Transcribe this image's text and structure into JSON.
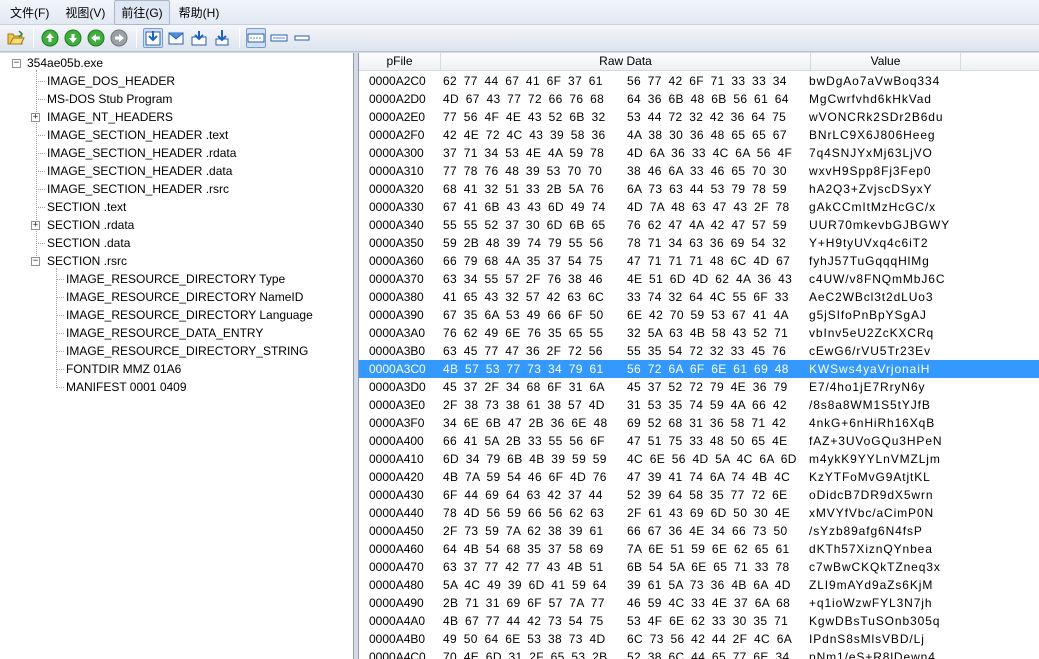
{
  "menu": {
    "items": [
      {
        "label": "文件(F)"
      },
      {
        "label": "视图(V)"
      },
      {
        "label": "前往(G)"
      },
      {
        "label": "帮助(H)"
      }
    ]
  },
  "toolbar": {
    "icons": [
      "open-folder-icon",
      "up-arrow-icon",
      "down-arrow-icon",
      "back-arrow-icon",
      "forward-arrow-icon",
      "export-icon",
      "mail-icon",
      "download-icon",
      "import-icon",
      "hex-view-icon",
      "split-view-icon",
      "minimal-view-icon"
    ]
  },
  "tree": {
    "root": "354ae05b.exe",
    "nodes": [
      {
        "label": "IMAGE_DOS_HEADER"
      },
      {
        "label": "MS-DOS Stub Program"
      },
      {
        "label": "IMAGE_NT_HEADERS"
      },
      {
        "label": "IMAGE_SECTION_HEADER .text"
      },
      {
        "label": "IMAGE_SECTION_HEADER .rdata"
      },
      {
        "label": "IMAGE_SECTION_HEADER .data"
      },
      {
        "label": "IMAGE_SECTION_HEADER .rsrc"
      },
      {
        "label": "SECTION .text"
      },
      {
        "label": "SECTION .rdata"
      },
      {
        "label": "SECTION .data"
      },
      {
        "label": "SECTION .rsrc"
      }
    ],
    "rsrc_children": [
      {
        "label": "IMAGE_RESOURCE_DIRECTORY Type"
      },
      {
        "label": "IMAGE_RESOURCE_DIRECTORY NameID"
      },
      {
        "label": "IMAGE_RESOURCE_DIRECTORY Language"
      },
      {
        "label": "IMAGE_RESOURCE_DATA_ENTRY"
      },
      {
        "label": "IMAGE_RESOURCE_DIRECTORY_STRING"
      },
      {
        "label": "FONTDIR  MMZ  01A6"
      },
      {
        "label": "MANIFEST  0001  0409"
      }
    ]
  },
  "hex": {
    "headers": {
      "pfile": "pFile",
      "raw": "Raw Data",
      "value": "Value"
    },
    "selected_row_offset": "0000A3C0",
    "rows": [
      {
        "off": "0000A2C0",
        "raw1": "62 77 44 67 41 6F 37 61",
        "raw2": "56 77 42 6F 71 33 33 34",
        "val": "bwDgAo7aVwBoq334"
      },
      {
        "off": "0000A2D0",
        "raw1": "4D 67 43 77 72 66 76 68",
        "raw2": "64 36 6B 48 6B 56 61 64",
        "val": "MgCwrfvhd6kHkVad"
      },
      {
        "off": "0000A2E0",
        "raw1": "77 56 4F 4E 43 52 6B 32",
        "raw2": "53 44 72 32 42 36 64 75",
        "val": "wVONCRk2SDr2B6du"
      },
      {
        "off": "0000A2F0",
        "raw1": "42 4E 72 4C 43 39 58 36",
        "raw2": "4A 38 30 36 48 65 65 67",
        "val": "BNrLC9X6J806Heeg"
      },
      {
        "off": "0000A300",
        "raw1": "37 71 34 53 4E 4A 59 78",
        "raw2": "4D 6A 36 33 4C 6A 56 4F",
        "val": "7q4SNJYxMj63LjVO"
      },
      {
        "off": "0000A310",
        "raw1": "77 78 76 48 39 53 70 70",
        "raw2": "38 46 6A 33 46 65 70 30",
        "val": "wxvH9Spp8Fj3Fep0"
      },
      {
        "off": "0000A320",
        "raw1": "68 41 32 51 33 2B 5A 76",
        "raw2": "6A 73 63 44 53 79 78 59",
        "val": "hA2Q3+ZvjscDSyxY"
      },
      {
        "off": "0000A330",
        "raw1": "67 41 6B 43 43 6D 49 74",
        "raw2": "4D 7A 48 63 47 43 2F 78",
        "val": "gAkCCmItMzHcGC/x"
      },
      {
        "off": "0000A340",
        "raw1": "55 55 52 37 30 6D 6B 65",
        "raw2": "76 62 47 4A 42 47 57 59",
        "val": "UUR70mkevbGJBGWY"
      },
      {
        "off": "0000A350",
        "raw1": "59 2B 48 39 74 79 55 56",
        "raw2": "78 71 34 63 36 69 54 32",
        "val": "Y+H9tyUVxq4c6iT2"
      },
      {
        "off": "0000A360",
        "raw1": "66 79 68 4A 35 37 54 75",
        "raw2": "47 71 71 71 48 6C 4D 67",
        "val": "fyhJ57TuGqqqHlMg"
      },
      {
        "off": "0000A370",
        "raw1": "63 34 55 57 2F 76 38 46",
        "raw2": "4E 51 6D 4D 62 4A 36 43",
        "val": "c4UW/v8FNQmMbJ6C"
      },
      {
        "off": "0000A380",
        "raw1": "41 65 43 32 57 42 63 6C",
        "raw2": "33 74 32 64 4C 55 6F 33",
        "val": "AeC2WBcl3t2dLUo3"
      },
      {
        "off": "0000A390",
        "raw1": "67 35 6A 53 49 66 6F 50",
        "raw2": "6E 42 70 59 53 67 41 4A",
        "val": "g5jSIfoPnBpYSgAJ"
      },
      {
        "off": "0000A3A0",
        "raw1": "76 62 49 6E 76 35 65 55",
        "raw2": "32 5A 63 4B 58 43 52 71",
        "val": "vbInv5eU2ZcKXCRq"
      },
      {
        "off": "0000A3B0",
        "raw1": "63 45 77 47 36 2F 72 56",
        "raw2": "55 35 54 72 32 33 45 76",
        "val": "cEwG6/rVU5Tr23Ev"
      },
      {
        "off": "0000A3C0",
        "raw1": "4B 57 53 77 73 34 79 61",
        "raw2": "56 72 6A 6F 6E 61 69 48",
        "val": "KWSws4yaVrjonaiH"
      },
      {
        "off": "0000A3D0",
        "raw1": "45 37 2F 34 68 6F 31 6A",
        "raw2": "45 37 52 72 79 4E 36 79",
        "val": "E7/4ho1jE7RryN6y"
      },
      {
        "off": "0000A3E0",
        "raw1": "2F 38 73 38 61 38 57 4D",
        "raw2": "31 53 35 74 59 4A 66 42",
        "val": "/8s8a8WM1S5tYJfB"
      },
      {
        "off": "0000A3F0",
        "raw1": "34 6E 6B 47 2B 36 6E 48",
        "raw2": "69 52 68 31 36 58 71 42",
        "val": "4nkG+6nHiRh16XqB"
      },
      {
        "off": "0000A400",
        "raw1": "66 41 5A 2B 33 55 56 6F",
        "raw2": "47 51 75 33 48 50 65 4E",
        "val": "fAZ+3UVoGQu3HPeN"
      },
      {
        "off": "0000A410",
        "raw1": "6D 34 79 6B 4B 39 59 59",
        "raw2": "4C 6E 56 4D 5A 4C 6A 6D",
        "val": "m4ykK9YYLnVMZLjm"
      },
      {
        "off": "0000A420",
        "raw1": "4B 7A 59 54 46 6F 4D 76",
        "raw2": "47 39 41 74 6A 74 4B 4C",
        "val": "KzYTFoMvG9AtjtKL"
      },
      {
        "off": "0000A430",
        "raw1": "6F 44 69 64 63 42 37 44",
        "raw2": "52 39 64 58 35 77 72 6E",
        "val": "oDidcB7DR9dX5wrn"
      },
      {
        "off": "0000A440",
        "raw1": "78 4D 56 59 66 56 62 63",
        "raw2": "2F 61 43 69 6D 50 30 4E",
        "val": "xMVYfVbc/aCimP0N"
      },
      {
        "off": "0000A450",
        "raw1": "2F 73 59 7A 62 38 39 61",
        "raw2": "66 67 36 4E 34 66 73 50",
        "val": "/sYzb89afg6N4fsP"
      },
      {
        "off": "0000A460",
        "raw1": "64 4B 54 68 35 37 58 69",
        "raw2": "7A 6E 51 59 6E 62 65 61",
        "val": "dKTh57XiznQYnbea"
      },
      {
        "off": "0000A470",
        "raw1": "63 37 77 42 77 43 4B 51",
        "raw2": "6B 54 5A 6E 65 71 33 78",
        "val": "c7wBwCKQkTZneq3x"
      },
      {
        "off": "0000A480",
        "raw1": "5A 4C 49 39 6D 41 59 64",
        "raw2": "39 61 5A 73 36 4B 6A 4D",
        "val": "ZLI9mAYd9aZs6KjM"
      },
      {
        "off": "0000A490",
        "raw1": "2B 71 31 69 6F 57 7A 77",
        "raw2": "46 59 4C 33 4E 37 6A 68",
        "val": "+q1ioWzwFYL3N7jh"
      },
      {
        "off": "0000A4A0",
        "raw1": "4B 67 77 44 42 73 54 75",
        "raw2": "53 4F 6E 62 33 30 35 71",
        "val": "KgwDBsTuSOnb305q"
      },
      {
        "off": "0000A4B0",
        "raw1": "49 50 64 6E 53 38 73 4D",
        "raw2": "6C 73 56 42 44 2F 4C 6A",
        "val": "IPdnS8sMlsVBD/Lj"
      },
      {
        "off": "0000A4C0",
        "raw1": "70 4E 6D 31 2F 65 53 2B",
        "raw2": "52 38 6C 44 65 77 6E 34",
        "val": "pNm1/eS+R8lDewn4"
      }
    ]
  }
}
